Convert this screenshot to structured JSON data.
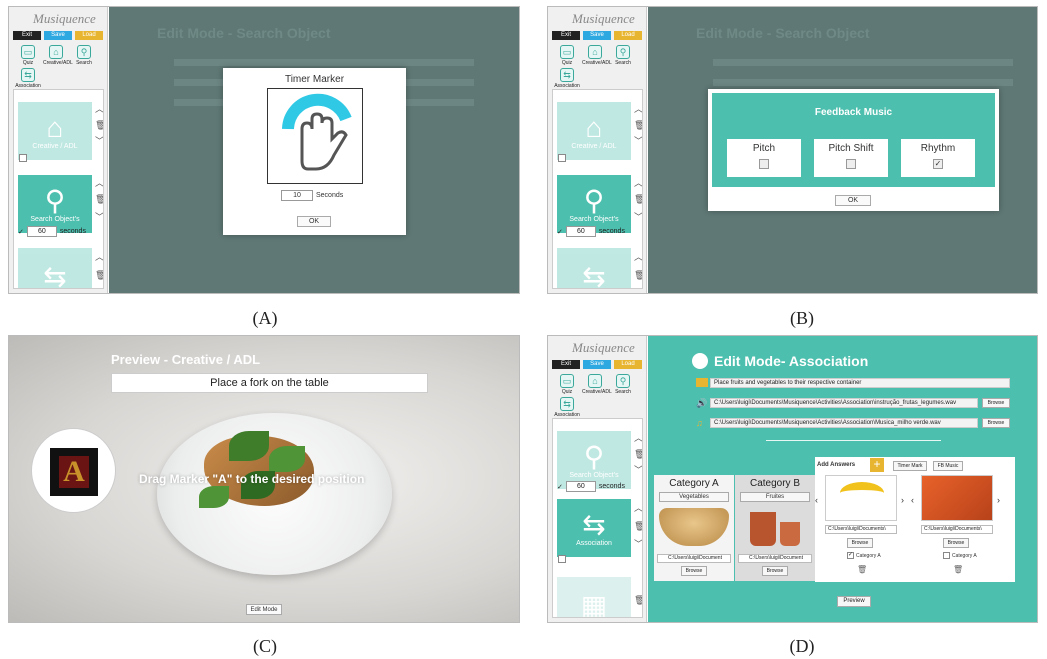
{
  "captions": {
    "a": "(A)",
    "b": "(B)",
    "c": "(C)",
    "d": "(D)"
  },
  "app": {
    "logo": "Musiquence",
    "exit": "Exit",
    "save": "Save",
    "load": "Load"
  },
  "tools": [
    {
      "label": "Quiz",
      "icon": "quiz-icon"
    },
    {
      "label": "Creative/ADL",
      "icon": "house-icon"
    },
    {
      "label": "Search",
      "icon": "magnifier-icon"
    },
    {
      "label": "Association",
      "icon": "association-icon"
    }
  ],
  "modules": {
    "creative": "Creative / ADL",
    "search": "Search Object's",
    "association": "Association",
    "seconds_value": "60",
    "seconds_label": "seconds"
  },
  "panel_a": {
    "title": "Timer Marker",
    "seconds_value": "10",
    "seconds_label": "Seconds",
    "ok": "OK",
    "bg_title": "Edit Mode - Search Object"
  },
  "panel_b": {
    "title": "Feedback Music",
    "options": [
      {
        "label": "Pitch",
        "checked": false
      },
      {
        "label": "Pitch Shift",
        "checked": false
      },
      {
        "label": "Rhythm",
        "checked": true
      }
    ],
    "ok": "OK",
    "bg_title": "Edit Mode - Search Object"
  },
  "panel_c": {
    "title": "Preview - Creative / ADL",
    "instruction": "Place a fork on the table",
    "marker_letter": "A",
    "drag_text": "Drag Marker \"A\" to the desired position",
    "edit_mode": "Edit Mode"
  },
  "panel_d": {
    "title": "Edit Mode- Association",
    "instruction": "Place fruits and vegetables to their respective container",
    "file1": "C:\\Users\\luigi\\Documents\\Musiquence\\Activities\\Association\\instrução_frutas_legumes.wav",
    "file2": "C:\\Users\\luigi\\Documents\\Musiquence\\Activities\\Association\\Musica_milho verde.wav",
    "browse": "Browse",
    "cat_a": "Category A",
    "cat_a_sub": "Vegetables",
    "cat_b": "Category B",
    "cat_b_sub": "Fruites",
    "path_short": "C:\\Users\\luigi\\Document",
    "path_ans": "C:\\Users\\luigi\\Documents\\",
    "add_answers": "Add Answers",
    "timer_mark": "Timer Mark",
    "fb_music": "FB Music",
    "ans1_cat": "Category A",
    "ans2_cat": "Category A",
    "preview": "Preview"
  }
}
